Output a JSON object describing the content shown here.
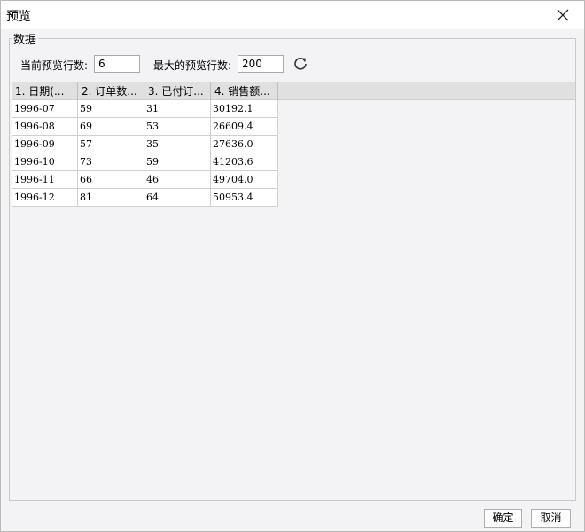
{
  "window": {
    "title": "预览"
  },
  "group": {
    "legend": "数据"
  },
  "settings": {
    "current_rows_label": "当前预览行数:",
    "current_rows_value": "6",
    "max_rows_label": "最大的预览行数:",
    "max_rows_value": "200"
  },
  "table": {
    "columns": [
      "1. 日期(...",
      "2. 订单数...",
      "3. 已付订...",
      "4. 销售额..."
    ],
    "rows": [
      [
        "1996-07",
        "59",
        "31",
        "30192.1"
      ],
      [
        "1996-08",
        "69",
        "53",
        "26609.4"
      ],
      [
        "1996-09",
        "57",
        "35",
        "27636.0"
      ],
      [
        "1996-10",
        "73",
        "59",
        "41203.6"
      ],
      [
        "1996-11",
        "66",
        "46",
        "49704.0"
      ],
      [
        "1996-12",
        "81",
        "64",
        "50953.4"
      ]
    ]
  },
  "footer": {
    "ok_label": "确定",
    "cancel_label": "取消"
  },
  "icons": {
    "close": "close-icon",
    "refresh": "refresh-icon"
  }
}
